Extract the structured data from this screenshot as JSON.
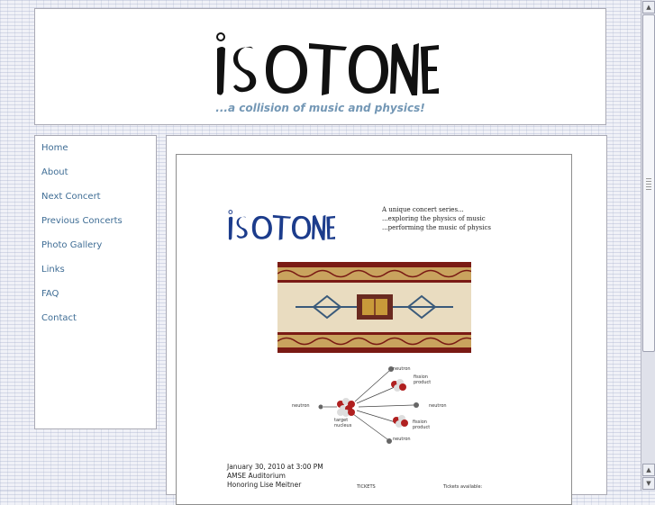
{
  "site": {
    "logo_text": "ISOTONE",
    "tagline": "...a collision of music and physics!"
  },
  "nav": {
    "items": [
      {
        "label": "Home"
      },
      {
        "label": "About"
      },
      {
        "label": "Next Concert"
      },
      {
        "label": "Previous Concerts"
      },
      {
        "label": "Photo Gallery"
      },
      {
        "label": "Links"
      },
      {
        "label": "FAQ"
      },
      {
        "label": "Contact"
      }
    ]
  },
  "poster": {
    "logo_text": "ISOTONE",
    "blurb": [
      "A unique concert series...",
      "...exploring the physics of music",
      "...performing the music of physics"
    ],
    "diagram_labels": {
      "neutron_in": "neutron",
      "neutron_top": "neutron",
      "fission_top": "fission product",
      "neutron_right": "neutron",
      "fission_bottom": "fission product",
      "target": "target nucleus",
      "neutron_bottom": "neutron"
    },
    "event_lines": [
      "January 30, 2010 at 3:00 PM",
      "AMSE Auditorium",
      "Honoring Lise Meitner"
    ],
    "tickets_label": "TICKETS",
    "tickets_available": "Tickets available:"
  },
  "colors": {
    "nav_link": "#3f6d95",
    "tagline": "#7397b5",
    "poster_logo": "#1c3c8c"
  },
  "scrollbar": {
    "up_icon": "arrow-up",
    "down_icon": "arrow-down"
  }
}
